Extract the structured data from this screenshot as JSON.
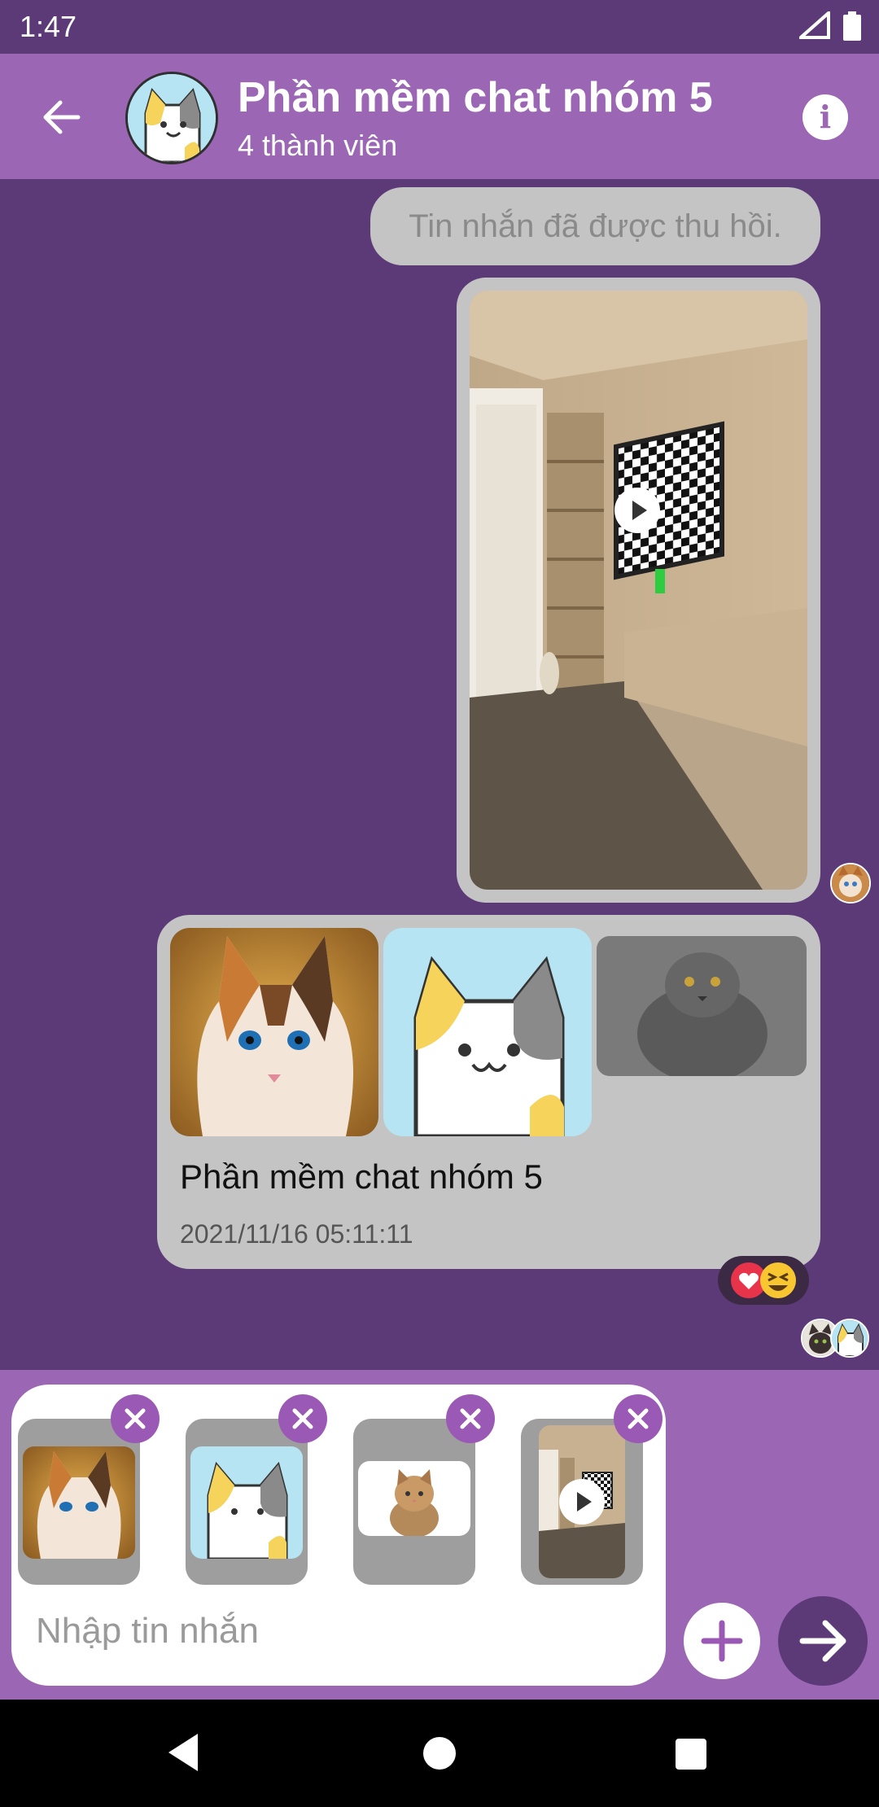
{
  "status_bar": {
    "time": "1:47",
    "icons": [
      "signal-icon",
      "battery-icon"
    ]
  },
  "header": {
    "title": "Phần mềm chat nhóm 5",
    "subtitle": "4 thành viên",
    "icons": [
      "back-arrow-icon",
      "info-icon"
    ]
  },
  "messages": {
    "recalled_text": "Tin nhắn đã được thu hồi.",
    "multi_text": "Phần mềm chat nhóm 5",
    "multi_time": "2021/11/16 05:11:11",
    "reactions": [
      "heart-icon",
      "laughing-emoji-icon"
    ]
  },
  "composer": {
    "placeholder": "Nhập tin nhắn",
    "attachments": [
      "calico-cat-photo",
      "cartoon-cat-image",
      "tabby-cat-photo",
      "room-video"
    ],
    "icons": [
      "remove-icon",
      "plus-icon",
      "send-arrow-icon"
    ]
  },
  "colors": {
    "background": "#5c3a78",
    "app_bar": "#9b66b4",
    "bubble": "#c4c4c4",
    "remove_badge": "#9b59b6",
    "send_button": "#5c3a78"
  },
  "nav": {
    "icons": [
      "nav-back-icon",
      "nav-home-icon",
      "nav-recent-icon"
    ]
  }
}
